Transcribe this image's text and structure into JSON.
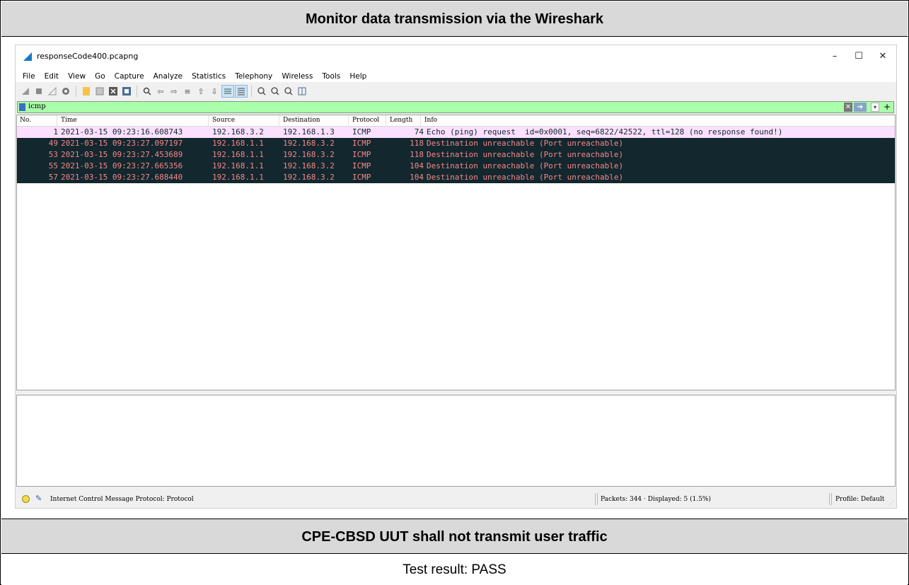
{
  "doc": {
    "title": "Monitor data transmission via the Wireshark",
    "subtitle": "CPE-CBSD UUT shall not transmit user traffic",
    "result": "Test result: PASS"
  },
  "window": {
    "title": "responseCode400.pcapng",
    "controls": {
      "minimize": "–",
      "maximize": "☐",
      "close": "✕"
    }
  },
  "menu": [
    "File",
    "Edit",
    "View",
    "Go",
    "Capture",
    "Analyze",
    "Statistics",
    "Telephony",
    "Wireless",
    "Tools",
    "Help"
  ],
  "filter": {
    "value": "icmp"
  },
  "columns": {
    "no": "No.",
    "time": "Time",
    "source": "Source",
    "destination": "Destination",
    "protocol": "Protocol",
    "length": "Length",
    "info": "Info"
  },
  "packets": [
    {
      "no": "1",
      "time": "2021-03-15 09:23:16.608743",
      "source": "192.168.3.2",
      "destination": "192.168.1.3",
      "protocol": "ICMP",
      "length": "74",
      "info": "Echo (ping) request  id=0x0001, seq=6822/42522, ttl=128 (no response found!)",
      "kind": "req"
    },
    {
      "no": "49",
      "time": "2021-03-15 09:23:27.097197",
      "source": "192.168.1.1",
      "destination": "192.168.3.2",
      "protocol": "ICMP",
      "length": "118",
      "info": "Destination unreachable (Port unreachable)",
      "kind": "err"
    },
    {
      "no": "53",
      "time": "2021-03-15 09:23:27.453689",
      "source": "192.168.1.1",
      "destination": "192.168.3.2",
      "protocol": "ICMP",
      "length": "118",
      "info": "Destination unreachable (Port unreachable)",
      "kind": "err"
    },
    {
      "no": "55",
      "time": "2021-03-15 09:23:27.665356",
      "source": "192.168.1.1",
      "destination": "192.168.3.2",
      "protocol": "ICMP",
      "length": "104",
      "info": "Destination unreachable (Port unreachable)",
      "kind": "err"
    },
    {
      "no": "57",
      "time": "2021-03-15 09:23:27.688440",
      "source": "192.168.1.1",
      "destination": "192.168.3.2",
      "protocol": "ICMP",
      "length": "104",
      "info": "Destination unreachable (Port unreachable)",
      "kind": "err"
    }
  ],
  "status": {
    "protocol": "Internet Control Message Protocol: Protocol",
    "packets": "Packets: 344 · Displayed: 5 (1.5%)",
    "profile": "Profile: Default"
  },
  "colors": {
    "filter_bg": "#aaffaa",
    "req_row_bg": "#fce0ff",
    "err_row_bg": "#12272e",
    "err_row_fg": "#f78787"
  }
}
